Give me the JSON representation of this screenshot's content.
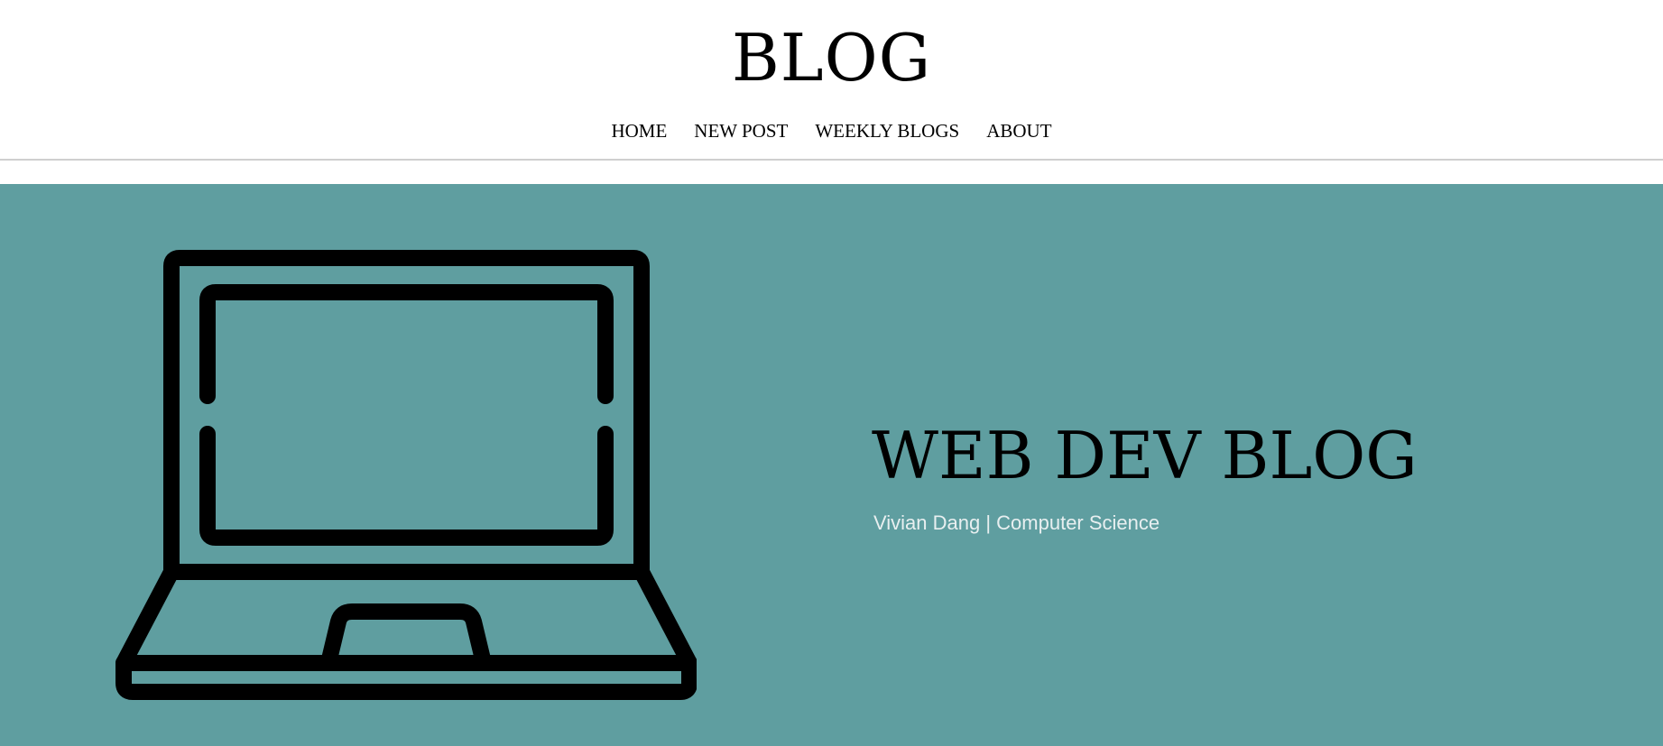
{
  "header": {
    "site_title": "BLOG"
  },
  "nav": {
    "items": [
      {
        "label": "HOME"
      },
      {
        "label": "NEW POST"
      },
      {
        "label": "WEEKLY BLOGS"
      },
      {
        "label": "ABOUT"
      }
    ]
  },
  "hero": {
    "title": "WEB DEV BLOG",
    "subtitle": "Vivian Dang | Computer Science",
    "icon": "laptop-icon",
    "background_color": "#5f9ea0"
  }
}
